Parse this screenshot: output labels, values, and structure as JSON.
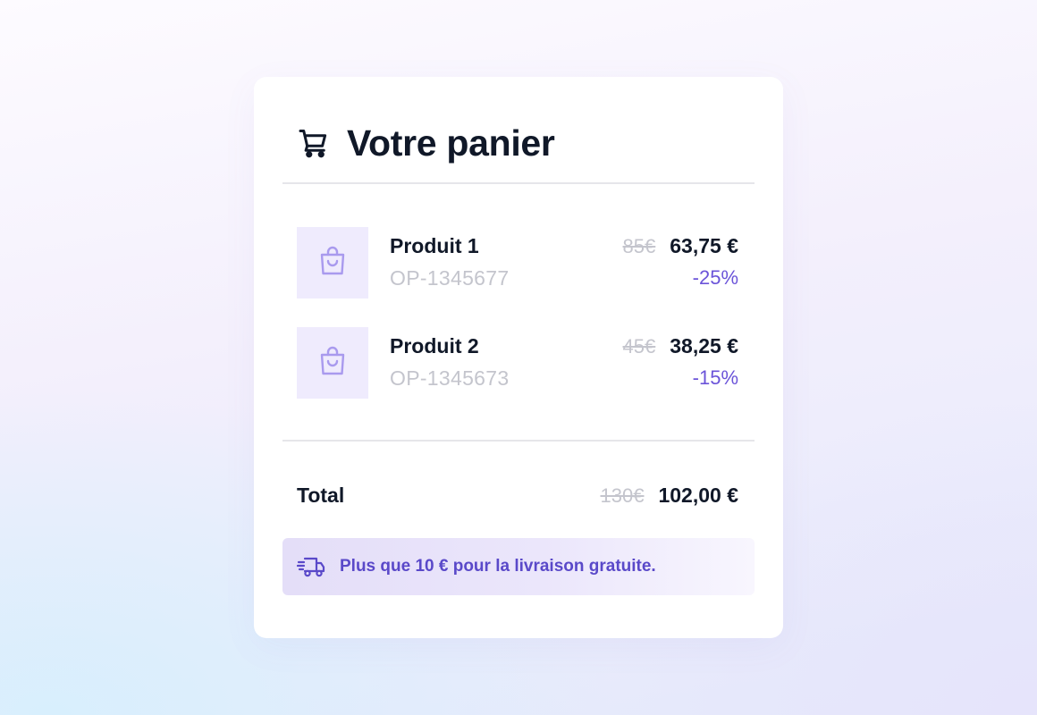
{
  "cart": {
    "title": "Votre panier",
    "icon": "cart-icon",
    "items": [
      {
        "name": "Produit 1",
        "sku": "OP-1345677",
        "old_price": "85€",
        "new_price": "63,75 €",
        "discount": "-25%",
        "icon": "shopping-bag-icon"
      },
      {
        "name": "Produit 2",
        "sku": "OP-1345673",
        "old_price": "45€",
        "new_price": "38,25 €",
        "discount": "-15%",
        "icon": "shopping-bag-icon"
      }
    ],
    "total": {
      "label": "Total",
      "old_price": "130€",
      "new_price": "102,00 €"
    },
    "shipping_banner": {
      "icon": "fast-delivery-truck-icon",
      "message": "Plus que 10 € pour la livraison gratuite."
    }
  },
  "colors": {
    "text": "#101828",
    "muted": "#c4c5cd",
    "accent": "#6b54d9",
    "thumb_bg": "#efebfd",
    "banner_text": "#5a49c9"
  }
}
